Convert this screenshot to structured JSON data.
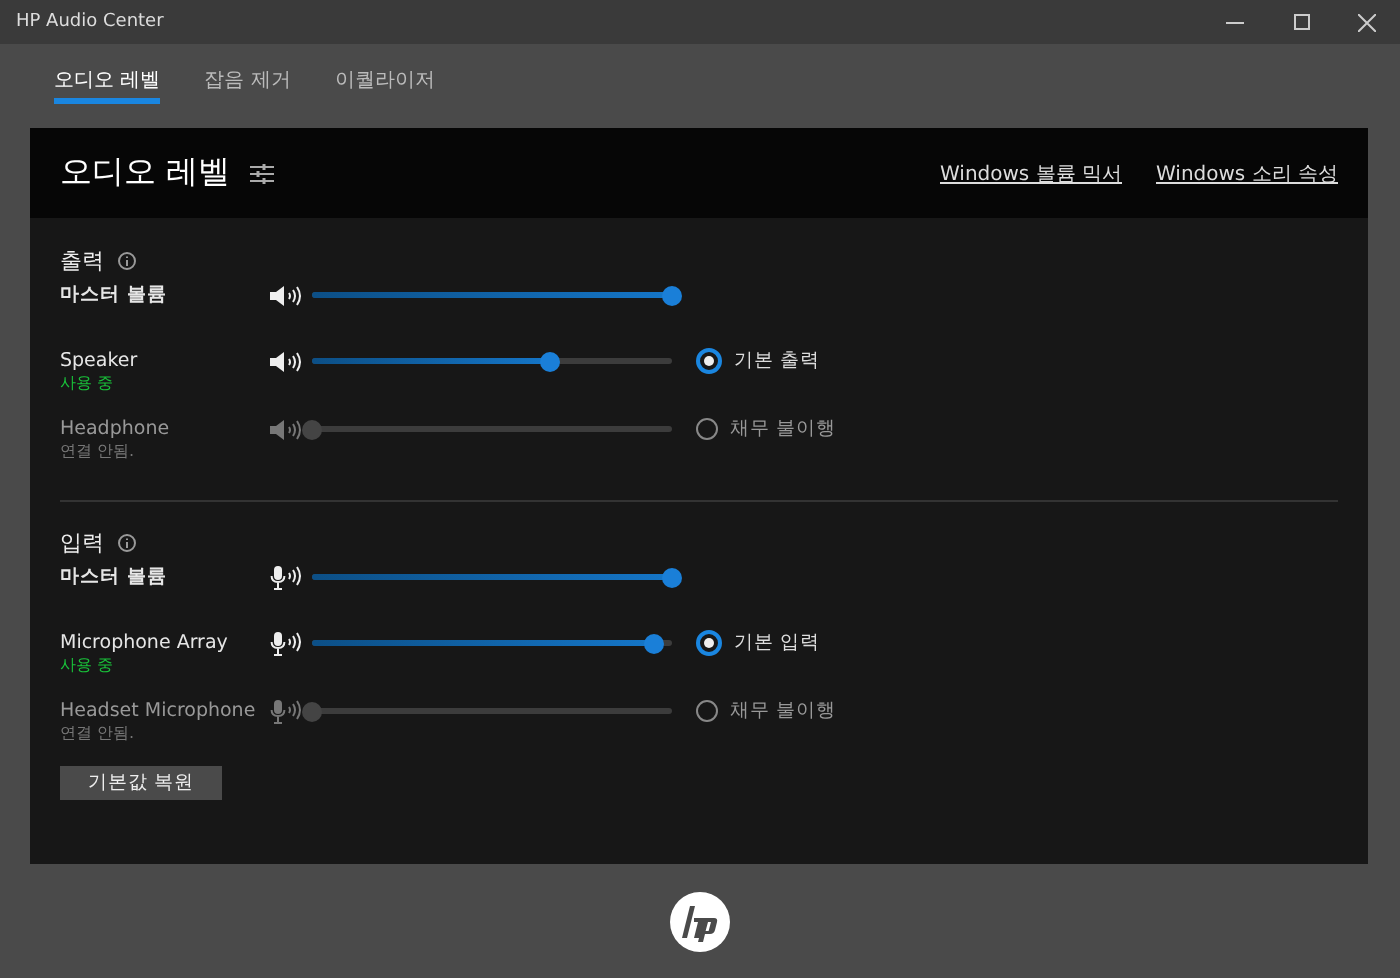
{
  "window": {
    "title": "HP Audio Center"
  },
  "tabs": [
    {
      "label": "오디오 레벨",
      "selected": true
    },
    {
      "label": "잡음 제거",
      "selected": false
    },
    {
      "label": "이퀄라이저",
      "selected": false
    }
  ],
  "panel": {
    "title": "오디오 레벨",
    "links": [
      "Windows 볼륨 믹서",
      "Windows 소리 속성"
    ]
  },
  "sections": [
    {
      "title": "출력",
      "kind": "output",
      "rows": [
        {
          "kind": "master",
          "name": "마스터 볼륨",
          "level": 1,
          "disabled": false
        },
        {
          "kind": "device",
          "name": "Speaker",
          "status": "사용 중",
          "level": 0.66,
          "disabled": false,
          "default_label": "기본 출력",
          "selected": true
        },
        {
          "kind": "device",
          "name": "Headphone",
          "status": "연결 안됨.",
          "level": 0,
          "disabled": true,
          "default_label": "채무 불이행",
          "selected": false
        }
      ]
    },
    {
      "title": "입력",
      "kind": "input",
      "rows": [
        {
          "kind": "master",
          "name": "마스터 볼륨",
          "level": 1,
          "disabled": false
        },
        {
          "kind": "device",
          "name": "Microphone Array",
          "status": "사용 중",
          "level": 0.95,
          "disabled": false,
          "default_label": "기본 입력",
          "selected": true
        },
        {
          "kind": "device",
          "name": "Headset Microphone",
          "status": "연결 안됨.",
          "level": 0,
          "disabled": true,
          "default_label": "채무 불이행",
          "selected": false
        }
      ]
    }
  ],
  "restore_button": "기본값 복원"
}
